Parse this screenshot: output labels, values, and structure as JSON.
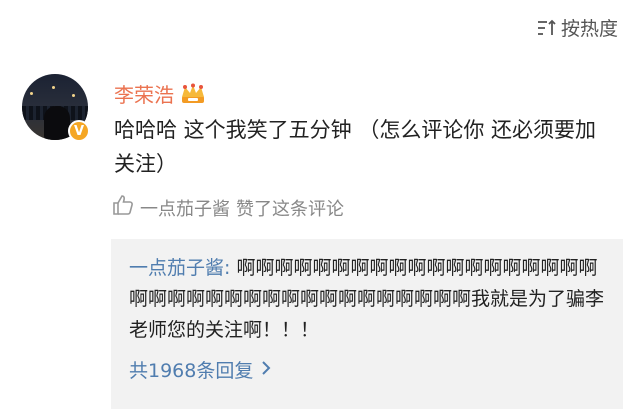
{
  "sort": {
    "label": "按热度",
    "icon": "sort-icon"
  },
  "comment": {
    "user": {
      "name": "李荣浩",
      "badge": "V",
      "crown_icon": "crown-icon"
    },
    "text": "哈哈哈 这个我笑了五分钟 （怎么评论你 还必须要加关注）",
    "like": {
      "icon": "thumbs-up-icon",
      "liker": "一点茄子酱",
      "action": "赞了这条评论"
    }
  },
  "reply": {
    "author": "一点茄子酱:",
    "text": " 啊啊啊啊啊啊啊啊啊啊啊啊啊啊啊啊啊啊啊啊啊啊啊啊啊啊啊啊啊啊啊啊啊啊啊啊啊我就是为了骗李老师您的关注啊！！！",
    "more_label": "共1968条回复",
    "more_icon": "chevron-right-icon"
  },
  "colors": {
    "username": "#eb7350",
    "link": "#507daf",
    "badge": "#f5a623",
    "reply_bg": "#f2f2f2"
  }
}
